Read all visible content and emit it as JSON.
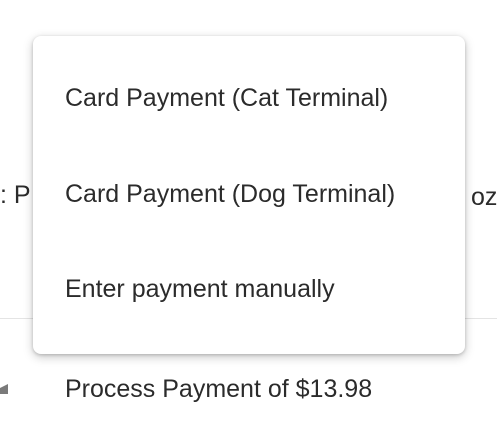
{
  "background": {
    "left_fragment": ": P",
    "right_fragment": "oz",
    "payment_row": {
      "icon": "card-icon",
      "label": "Process Payment of $13.98"
    }
  },
  "payment_menu": {
    "items": [
      {
        "label": "Card Payment (Cat Terminal)"
      },
      {
        "label": "Card Payment (Dog Terminal)"
      },
      {
        "label": "Enter payment manually"
      }
    ]
  },
  "colors": {
    "text": "#2b2b2b",
    "divider": "#e4e4e4",
    "menu_background": "#ffffff"
  }
}
